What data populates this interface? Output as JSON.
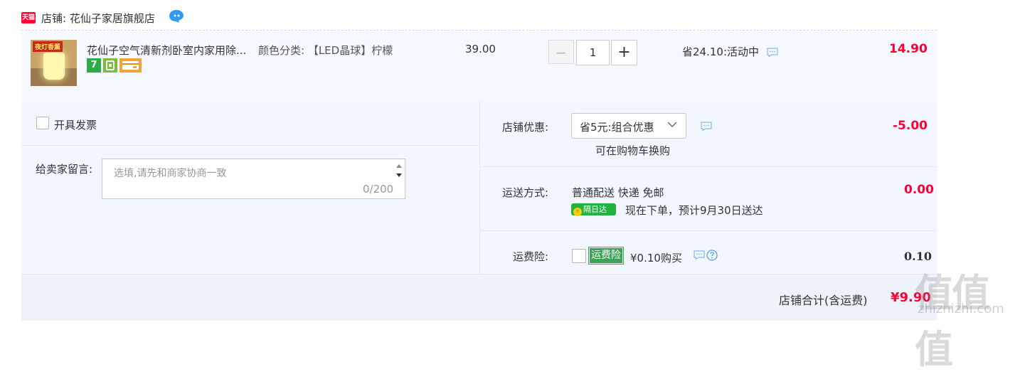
{
  "store": {
    "badge": "天猫",
    "label": "店铺: 花仙子家居旗舰店"
  },
  "item": {
    "thumb_caption": "夜灯香薰",
    "title": "花仙子空气清新剂卧室内家用除...",
    "sku": "颜色分类: 【LED晶球】柠檬",
    "badge_seven": "7",
    "price": "39.00",
    "qty_minus": "−",
    "quantity": "1",
    "qty_plus": "+",
    "promo": "省24.10:活动中",
    "line_total": "14.90"
  },
  "invoice": {
    "label": "开具发票"
  },
  "memo": {
    "label": "给卖家留言:",
    "placeholder": "选填,请先和商家协商一致",
    "counter": "0/200"
  },
  "shop_discount": {
    "label": "店铺优惠:",
    "selected": "省5元:组合优惠",
    "note": "可在购物车换购",
    "amount": "-5.00"
  },
  "shipping": {
    "label": "运送方式:",
    "method": "普通配送 快递 免邮",
    "badge": "隔日达",
    "eta": "现在下单，预计9月30日送达",
    "amount": "0.00"
  },
  "shipping_insurance": {
    "label": "运费险:",
    "badge": "运费险",
    "price_text": "¥0.10购买",
    "amount": "0.10"
  },
  "total": {
    "label": "店铺合计(含运费)",
    "amount": "¥9.90"
  },
  "watermark": {
    "glyphs": "值值值",
    "site": "zhizhizhi.com"
  },
  "colors": {
    "accent_red": "#ff0036",
    "row_bg": "#f5f9ff",
    "panel_bg": "#f2f7ff",
    "badge_green": "#20b33f",
    "insurance_green": "#3aa356"
  }
}
